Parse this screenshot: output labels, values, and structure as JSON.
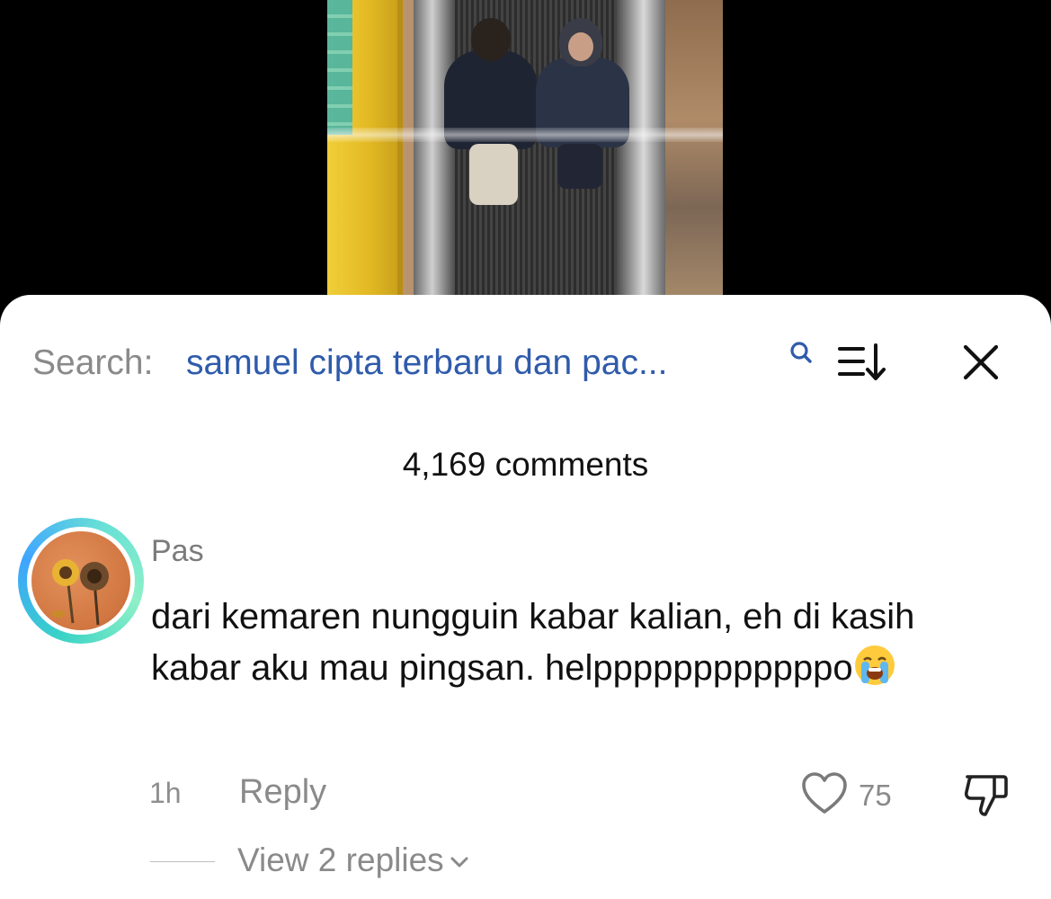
{
  "video": {
    "description_icon": "video-frame"
  },
  "comments_sheet": {
    "search_label": "Search:",
    "search_query": "samuel cipta terbaru dan pac...",
    "icons": {
      "search": "search-icon",
      "sort": "sort-icon",
      "close": "close-icon"
    },
    "comment_count": "4,169 comments"
  },
  "comment": {
    "username": "Pas",
    "text": "dari kemaren nungguin kabar kalian, eh di kasih kabar aku mau pingsan. helppppppppppppo",
    "emoji": "loudly-crying-face",
    "time": "1h",
    "reply_label": "Reply",
    "likes": "75",
    "view_replies": "View 2 replies"
  },
  "colors": {
    "query_blue": "#2f5bab",
    "muted_gray": "#8a8a8a",
    "avatar_ring": "#39d3c6"
  }
}
